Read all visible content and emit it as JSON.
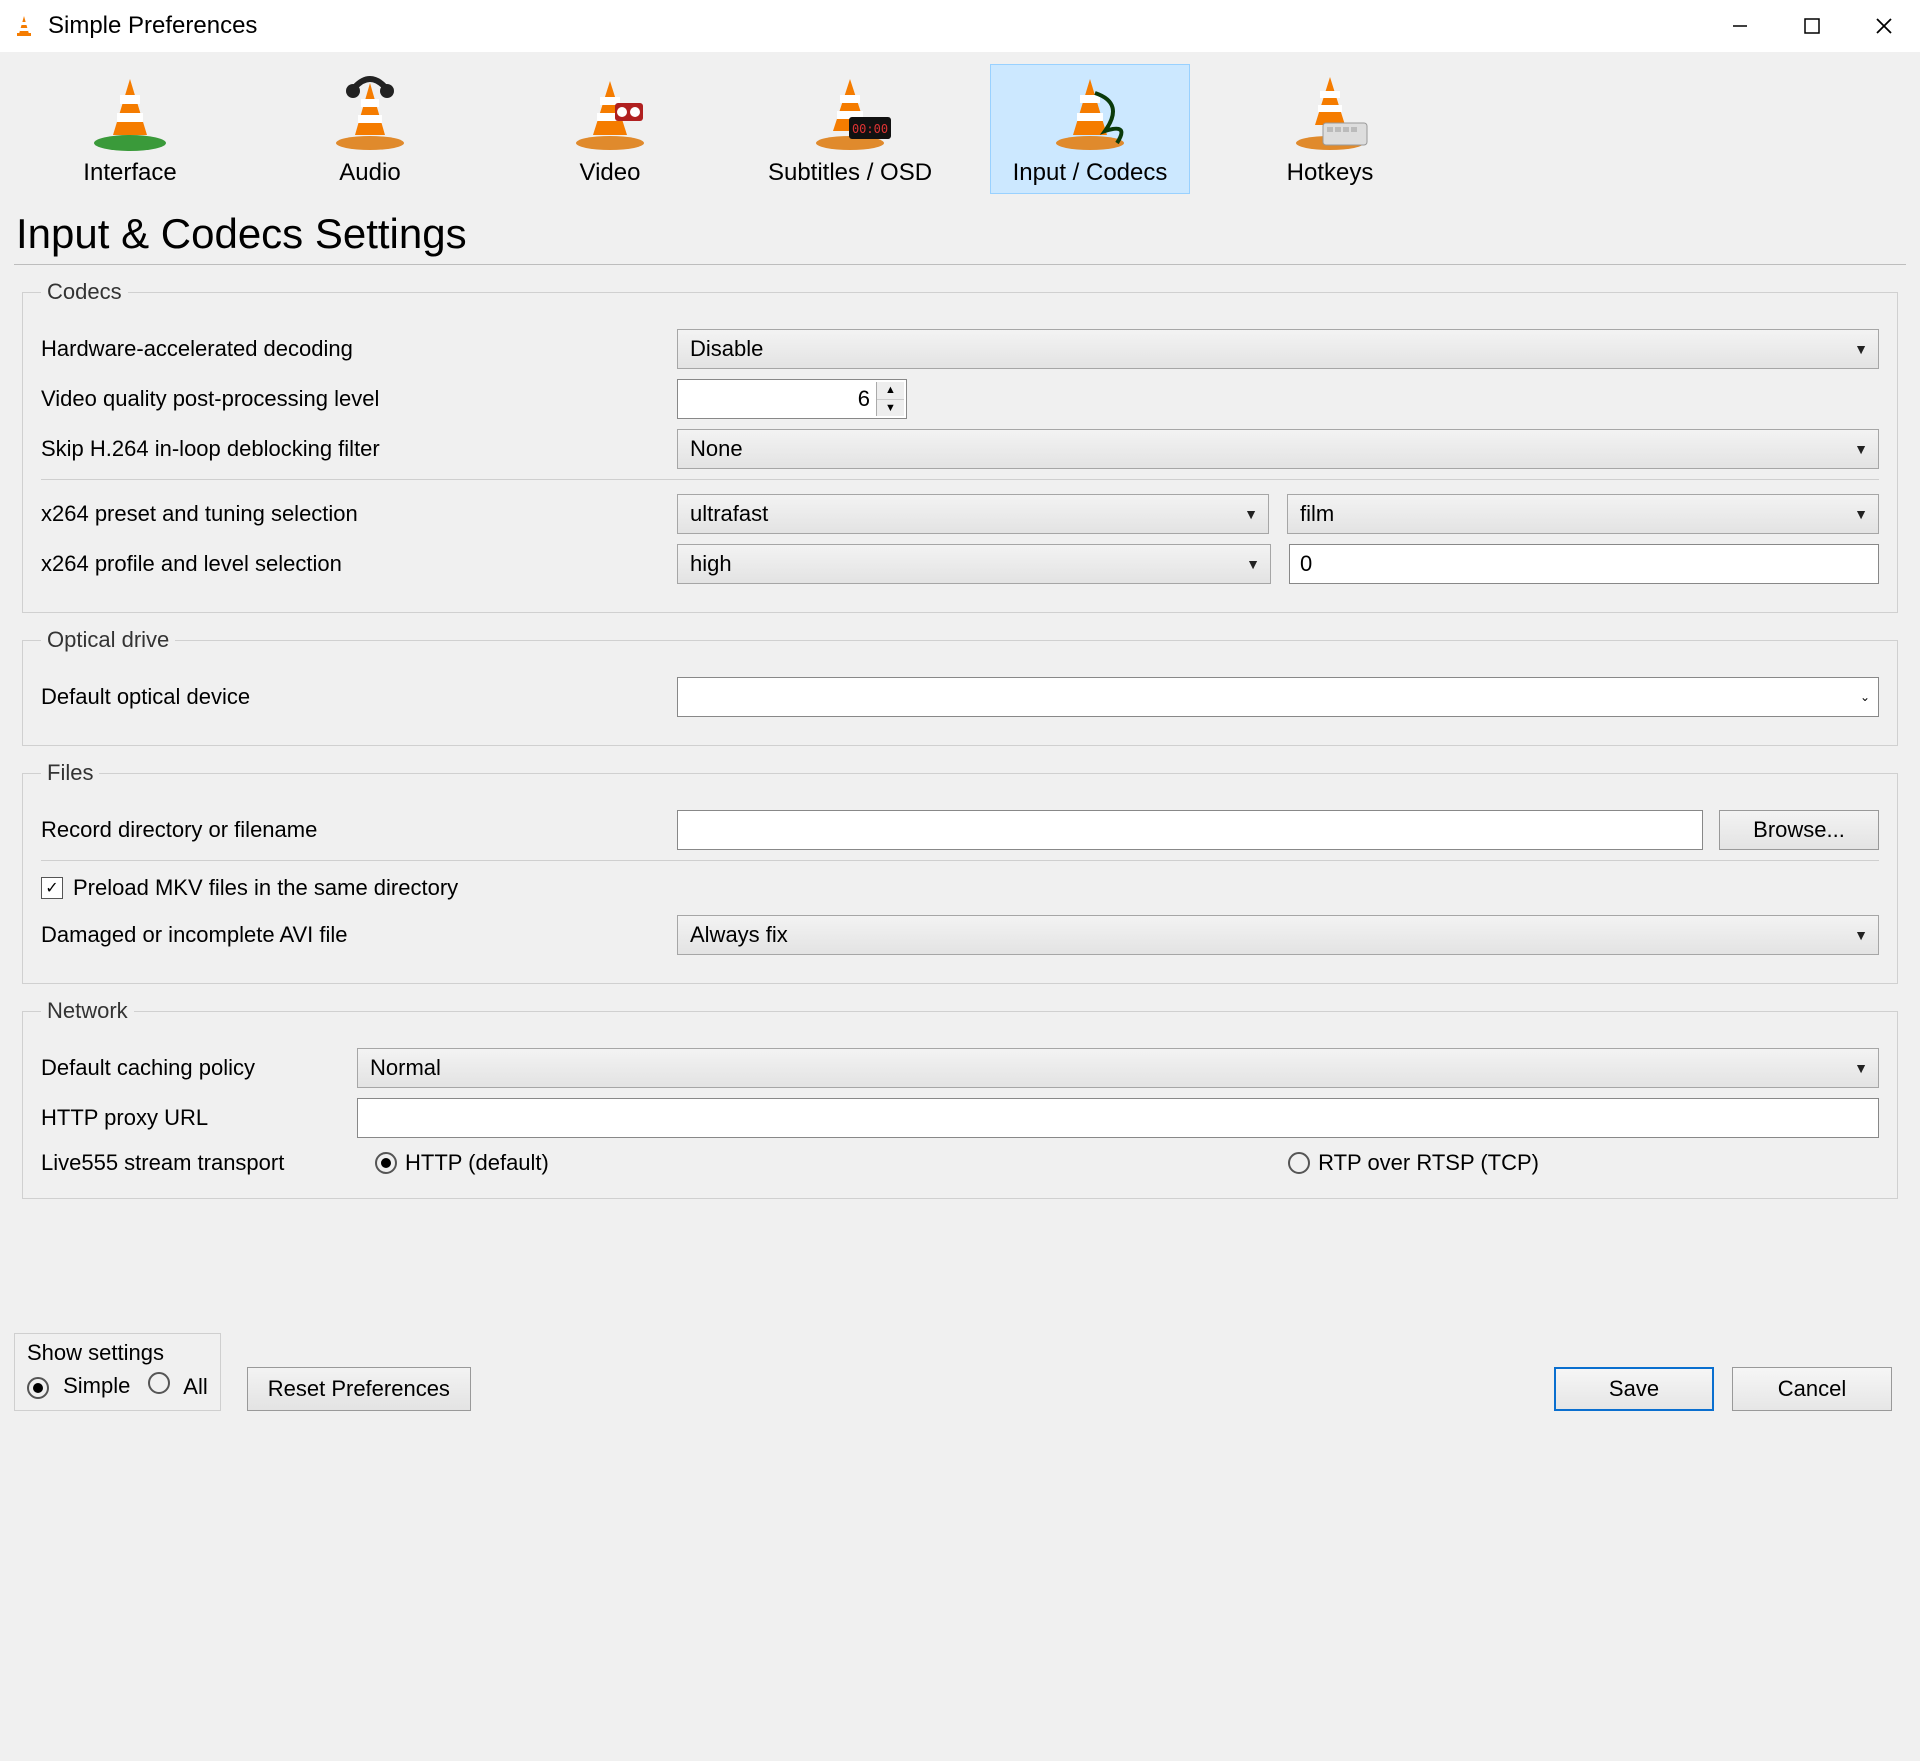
{
  "title": "Simple Preferences",
  "tabs": [
    {
      "label": "Interface"
    },
    {
      "label": "Audio"
    },
    {
      "label": "Video"
    },
    {
      "label": "Subtitles / OSD"
    },
    {
      "label": "Input / Codecs"
    },
    {
      "label": "Hotkeys"
    }
  ],
  "page_title": "Input & Codecs Settings",
  "codecs": {
    "legend": "Codecs",
    "hw_decoding_label": "Hardware-accelerated decoding",
    "hw_decoding_value": "Disable",
    "postproc_label": "Video quality post-processing level",
    "postproc_value": "6",
    "skip_h264_label": "Skip H.264 in-loop deblocking filter",
    "skip_h264_value": "None",
    "x264_preset_label": "x264 preset and tuning selection",
    "x264_preset_value": "ultrafast",
    "x264_tuning_value": "film",
    "x264_profile_label": "x264 profile and level selection",
    "x264_profile_value": "high",
    "x264_level_value": "0"
  },
  "optical": {
    "legend": "Optical drive",
    "device_label": "Default optical device",
    "device_value": ""
  },
  "files": {
    "legend": "Files",
    "record_label": "Record directory or filename",
    "record_value": "",
    "browse_label": "Browse...",
    "preload_label": "Preload MKV files in the same directory",
    "avi_label": "Damaged or incomplete AVI file",
    "avi_value": "Always fix"
  },
  "network": {
    "legend": "Network",
    "caching_label": "Default caching policy",
    "caching_value": "Normal",
    "proxy_label": "HTTP proxy URL",
    "proxy_value": "",
    "live555_label": "Live555 stream transport",
    "http_label": "HTTP (default)",
    "rtp_label": "RTP over RTSP (TCP)"
  },
  "footer": {
    "show_settings_label": "Show settings",
    "simple_label": "Simple",
    "all_label": "All",
    "reset_label": "Reset Preferences",
    "save_label": "Save",
    "cancel_label": "Cancel"
  }
}
